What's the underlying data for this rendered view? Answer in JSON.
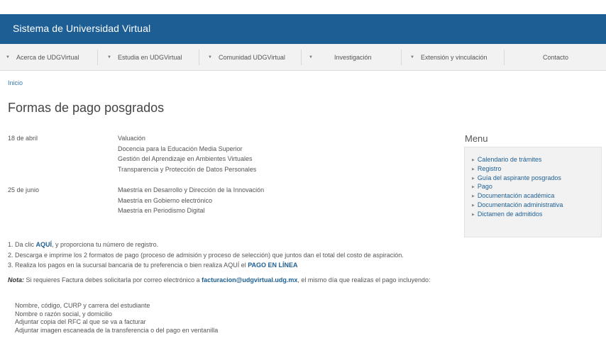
{
  "header": {
    "title": "Sistema de Universidad Virtual"
  },
  "nav": {
    "items": [
      {
        "label": "Acerca de UDGVirtual",
        "has_caret": true
      },
      {
        "label": "Estudia en UDGVirtual",
        "has_caret": true
      },
      {
        "label": "Comunidad UDGVirtual",
        "has_caret": true
      },
      {
        "label": "Investigación",
        "has_caret": true
      },
      {
        "label": "Extensión y vinculación",
        "has_caret": true
      },
      {
        "label": "Contacto",
        "has_caret": false
      }
    ]
  },
  "breadcrumb": {
    "home": "Inicio"
  },
  "page": {
    "title": "Formas de pago posgrados"
  },
  "schedule": [
    {
      "date": "18 de abril",
      "programs": [
        "Valuación",
        "Docencia para la Educación Media Superior",
        "Gestión del Aprendizaje en Ambientes Virtuales",
        "Transparencia y Protección de Datos Personales"
      ]
    },
    {
      "date": "25 de junio",
      "programs": [
        "Maestría en Desarrollo y Dirección de la Innovación",
        "Maestría en Gobierno electrónico",
        "Maestría en Periodismo Digital"
      ]
    }
  ],
  "steps": {
    "s1_pre": "1. Da clic ",
    "s1_link": "AQUÍ",
    "s1_post": ", y proporciona tu número de registro.",
    "s2": "2. Descarga e imprime los 2 formatos de pago (proceso de admisión y proceso de selección) que juntos dan el total del costo de aspiración.",
    "s3_pre": "3. Realiza los pagos en la sucursal bancaria de tu preferencia o bien realiza AQUÍ el ",
    "s3_link": "PAGO EN LÍNEA"
  },
  "note": {
    "label": "Nota:",
    "pre": " Si requieres Factura debes solicitarla por correo electrónico a ",
    "email": "facturacion@udgvirtual.udg.mx",
    "post": ", el mismo día que realizas el pago incluyendo:"
  },
  "requirements": [
    "Nombre, código, CURP y carrera del estudiante",
    "Nombre o razón social,  y domicilio",
    "Adjuntar copia del RFC al que se va a facturar",
    "Adjuntar imagen escaneada de la transferencia o del pago en ventanilla"
  ],
  "menu": {
    "title": "Menu",
    "items": [
      "Calendario de trámites",
      "Registro",
      "Guía del aspirante posgrados",
      "Pago",
      "Documentación académica",
      "Documentación administrativa",
      "Dictamen de admitidos"
    ]
  },
  "colors": {
    "header_bg": "#1d5f94",
    "link": "#1d5f94",
    "nav_bg": "#f2f2f2"
  }
}
